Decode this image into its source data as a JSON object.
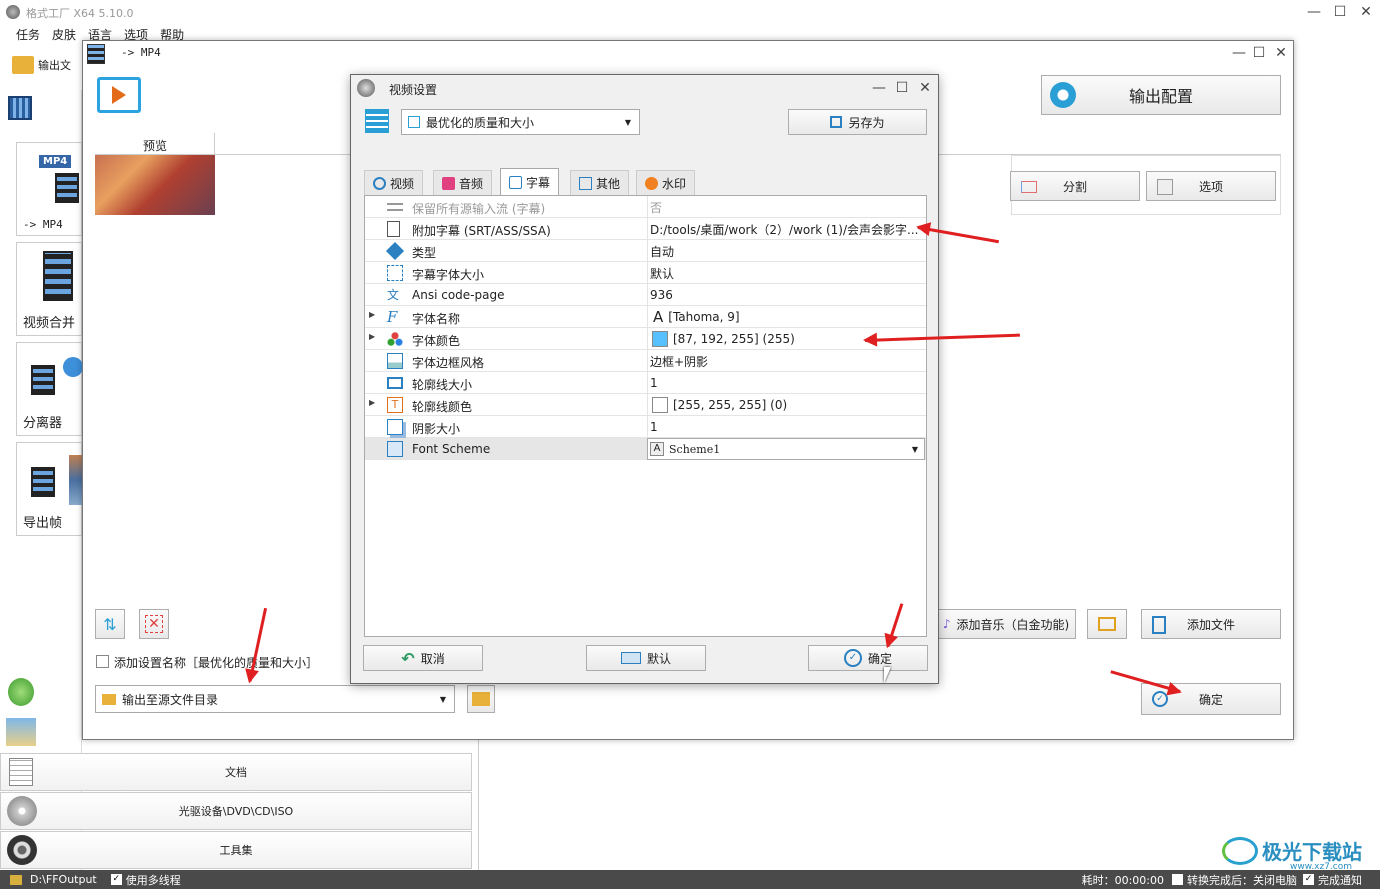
{
  "app": {
    "title": "格式工厂 X64 5.10.0",
    "menu": [
      "任务",
      "皮肤",
      "语言",
      "选项",
      "帮助"
    ],
    "output_folder_btn": "输出文",
    "output_config": "输出配置",
    "split": "分割",
    "options": "选项",
    "add_music": "添加音乐（白金功能)",
    "add_file": "添加文件",
    "confirm": "确定"
  },
  "left_buttons": [
    {
      "label": "-> MP4",
      "badge": "MP4"
    },
    {
      "label": "视频合并"
    },
    {
      "label": "分离器"
    },
    {
      "label": "导出帧"
    }
  ],
  "categories": [
    "文档",
    "光驱设备\\DVD\\CD\\ISO",
    "工具集"
  ],
  "mp4_window": {
    "title": "-> MP4",
    "preview_header": "预览",
    "add_setting_name": "添加设置名称［最优化的质量和大小］",
    "output_dir": "输出至源文件目录"
  },
  "dialog": {
    "title": "视频设置",
    "preset": "最优化的质量和大小",
    "save_as": "另存为",
    "tabs": [
      {
        "label": "视频",
        "icon": "video-tab-icon"
      },
      {
        "label": "音频",
        "icon": "music-tab-icon"
      },
      {
        "label": "字幕",
        "icon": "subtitle-tab-icon"
      },
      {
        "label": "其他",
        "icon": "sliders-tab-icon"
      },
      {
        "label": "水印",
        "icon": "watermark-tab-icon"
      }
    ],
    "active_tab": "字幕",
    "properties": [
      {
        "name": "保留所有源输入流 (字幕)",
        "value": "否",
        "icon": "list-icon",
        "dim": true
      },
      {
        "name": "附加字幕 (SRT/ASS/SSA)",
        "value": "D:/tools/桌面/work（2）/work (1)/会声会影字...",
        "icon": "document-icon"
      },
      {
        "name": "类型",
        "value": "自动",
        "icon": "cube-icon"
      },
      {
        "name": "字幕字体大小",
        "value": "默认",
        "icon": "resize-icon"
      },
      {
        "name": "Ansi code-page",
        "value": "936",
        "icon": "translate-icon"
      },
      {
        "name": "字体名称",
        "value": "[Tahoma, 9]",
        "icon": "font-icon",
        "expandable": true,
        "value_icon": "A"
      },
      {
        "name": "字体颜色",
        "value": "[87, 192, 255] (255)",
        "icon": "palette-icon",
        "expandable": true,
        "swatch": "#57c0ff"
      },
      {
        "name": "字体边框风格",
        "value": "边框+阴影",
        "icon": "image-icon"
      },
      {
        "name": "轮廓线大小",
        "value": "1",
        "icon": "rectangle-icon"
      },
      {
        "name": "轮廓线颜色",
        "value": "[255, 255, 255] (0)",
        "icon": "text-t-icon",
        "expandable": true,
        "swatch": "#ffffff"
      },
      {
        "name": "阴影大小",
        "value": "1",
        "icon": "shadow-icon"
      },
      {
        "name": "Font Scheme",
        "value": "Scheme1",
        "icon": "scheme-icon",
        "selected": true
      }
    ],
    "cancel": "取消",
    "default": "默认",
    "ok": "确定"
  },
  "status": {
    "path": "D:\\FFOutput",
    "multithread": "使用多线程",
    "elapsed": "耗时：00:00:00",
    "after_convert": "转换完成后：关闭电脑",
    "notify": "完成通知"
  },
  "watermark": {
    "name": "极光下载站",
    "url": "www.xz7.com"
  },
  "colors": {
    "accent": "#2a9fd6",
    "arrow": "#e02020",
    "font_color": "#57c0ff"
  }
}
